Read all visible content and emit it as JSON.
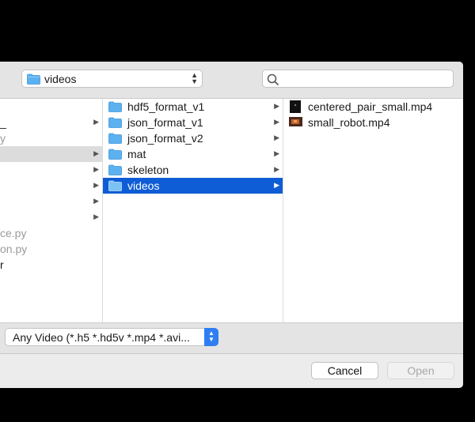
{
  "location": {
    "folder": "videos"
  },
  "search": {
    "placeholder": ""
  },
  "column1": [
    {
      "label": "_",
      "dim": false
    },
    {
      "label": "y",
      "dim": true
    },
    {
      "label": "",
      "dim": false
    },
    {
      "label": "",
      "dim": false
    },
    {
      "label": "",
      "dim": false
    },
    {
      "label": "",
      "dim": false
    },
    {
      "label": "",
      "dim": false
    },
    {
      "label": "ce.py",
      "dim": true
    },
    {
      "label": "on.py",
      "dim": true
    },
    {
      "label": "r",
      "dim": false
    }
  ],
  "column2": [
    {
      "label": "hdf5_format_v1"
    },
    {
      "label": "json_format_v1"
    },
    {
      "label": "json_format_v2"
    },
    {
      "label": "mat"
    },
    {
      "label": "skeleton"
    },
    {
      "label": "videos"
    }
  ],
  "column3": [
    {
      "label": "centered_pair_small.mp4"
    },
    {
      "label": "small_robot.mp4"
    }
  ],
  "filter": {
    "selected": "Any Video (*.h5 *.hd5v *.mp4 *.avi..."
  },
  "buttons": {
    "cancel": "Cancel",
    "open": "Open"
  },
  "colors": {
    "selection": "#0f5dd6",
    "accent": "#2f7ff2",
    "folder": "#5cb1f0"
  }
}
